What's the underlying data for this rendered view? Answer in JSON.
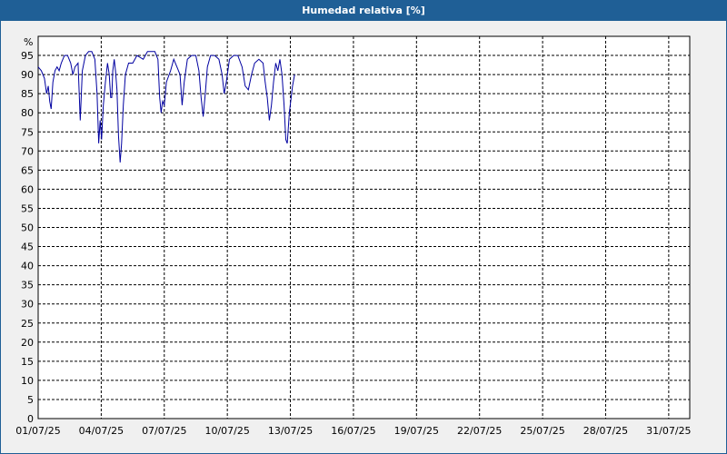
{
  "window": {
    "title": "Humedad relativa [%]"
  },
  "colors": {
    "title_bar": "#1f5f96",
    "plot_background": "#ffffff",
    "line": "#0000a0",
    "grid": "#000000"
  },
  "chart_data": {
    "type": "line",
    "title": "Humedad relativa [%]",
    "ylabel": "%",
    "xlabel": "",
    "ylim": [
      0,
      100
    ],
    "xlim_days": [
      0,
      31
    ],
    "grid": true,
    "grid_style": "dashed",
    "y_ticks": [
      0,
      5,
      10,
      15,
      20,
      25,
      30,
      35,
      40,
      45,
      50,
      55,
      60,
      65,
      70,
      75,
      80,
      85,
      90,
      95
    ],
    "x_tick_labels": [
      "01/07/25",
      "04/07/25",
      "07/07/25",
      "10/07/25",
      "13/07/25",
      "16/07/25",
      "19/07/25",
      "22/07/25",
      "25/07/25",
      "28/07/25",
      "31/07/25"
    ],
    "series": [
      {
        "points": [
          [
            0.0,
            92
          ],
          [
            0.15,
            91
          ],
          [
            0.3,
            89
          ],
          [
            0.4,
            85
          ],
          [
            0.48,
            87
          ],
          [
            0.55,
            83
          ],
          [
            0.62,
            81
          ],
          [
            0.7,
            88
          ],
          [
            0.8,
            91
          ],
          [
            0.9,
            92
          ],
          [
            1.0,
            91
          ],
          [
            1.1,
            93
          ],
          [
            1.25,
            95
          ],
          [
            1.4,
            95
          ],
          [
            1.55,
            93
          ],
          [
            1.65,
            90
          ],
          [
            1.75,
            92
          ],
          [
            1.9,
            93
          ],
          [
            2.0,
            78
          ],
          [
            2.1,
            91
          ],
          [
            2.25,
            95
          ],
          [
            2.4,
            96
          ],
          [
            2.55,
            96
          ],
          [
            2.7,
            94
          ],
          [
            2.8,
            85
          ],
          [
            2.88,
            72
          ],
          [
            2.95,
            78
          ],
          [
            3.02,
            73
          ],
          [
            3.1,
            82
          ],
          [
            3.2,
            88
          ],
          [
            3.3,
            93
          ],
          [
            3.38,
            90
          ],
          [
            3.45,
            84
          ],
          [
            3.5,
            84
          ],
          [
            3.55,
            91
          ],
          [
            3.62,
            94
          ],
          [
            3.68,
            91
          ],
          [
            3.75,
            86
          ],
          [
            3.82,
            74
          ],
          [
            3.9,
            67
          ],
          [
            3.97,
            72
          ],
          [
            4.05,
            82
          ],
          [
            4.15,
            90
          ],
          [
            4.3,
            93
          ],
          [
            4.5,
            93
          ],
          [
            4.7,
            95
          ],
          [
            5.0,
            94
          ],
          [
            5.2,
            96
          ],
          [
            5.4,
            96
          ],
          [
            5.55,
            96
          ],
          [
            5.7,
            94
          ],
          [
            5.78,
            84
          ],
          [
            5.85,
            80
          ],
          [
            5.92,
            83
          ],
          [
            6.0,
            82
          ],
          [
            6.1,
            88
          ],
          [
            6.3,
            91
          ],
          [
            6.45,
            94
          ],
          [
            6.6,
            92
          ],
          [
            6.75,
            90
          ],
          [
            6.85,
            82
          ],
          [
            6.95,
            88
          ],
          [
            7.1,
            94
          ],
          [
            7.3,
            95
          ],
          [
            7.5,
            95
          ],
          [
            7.65,
            91
          ],
          [
            7.75,
            84
          ],
          [
            7.85,
            79
          ],
          [
            7.95,
            85
          ],
          [
            8.05,
            92
          ],
          [
            8.2,
            95
          ],
          [
            8.4,
            95
          ],
          [
            8.6,
            94
          ],
          [
            8.75,
            90
          ],
          [
            8.85,
            85
          ],
          [
            8.95,
            88
          ],
          [
            9.1,
            94
          ],
          [
            9.3,
            95
          ],
          [
            9.5,
            95
          ],
          [
            9.7,
            92
          ],
          [
            9.85,
            87
          ],
          [
            10.0,
            86
          ],
          [
            10.15,
            90
          ],
          [
            10.3,
            93
          ],
          [
            10.5,
            94
          ],
          [
            10.7,
            93
          ],
          [
            10.8,
            88
          ],
          [
            10.9,
            84
          ],
          [
            11.0,
            78
          ],
          [
            11.1,
            82
          ],
          [
            11.2,
            88
          ],
          [
            11.3,
            93
          ],
          [
            11.4,
            91
          ],
          [
            11.5,
            94
          ],
          [
            11.6,
            90
          ],
          [
            11.7,
            82
          ],
          [
            11.78,
            73
          ],
          [
            11.85,
            72
          ],
          [
            11.95,
            80
          ],
          [
            12.1,
            87
          ],
          [
            12.2,
            90
          ]
        ]
      }
    ]
  }
}
